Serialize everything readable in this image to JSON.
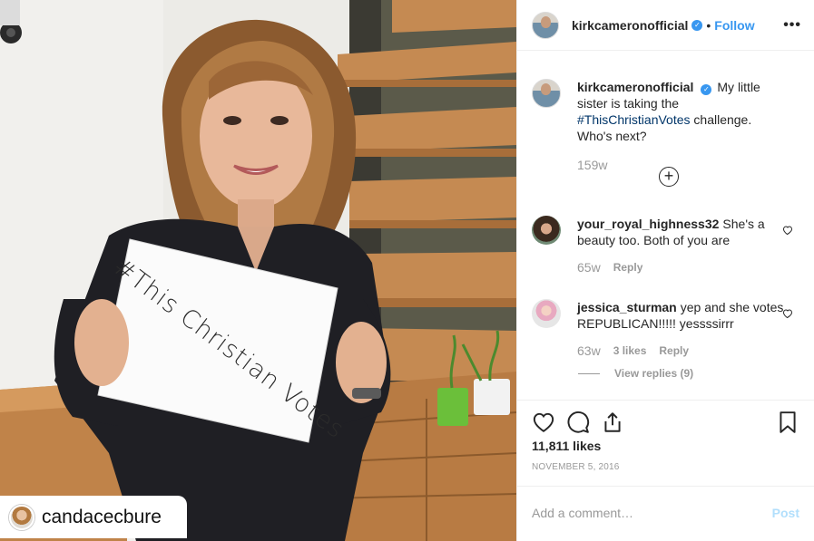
{
  "photo": {
    "sign_text": "#This Christian Votes",
    "repost_user": "candacecbure",
    "colors": {
      "wall": "#ecebe7",
      "stairs": "#c0824a",
      "shirt": "#1f1f24",
      "hair": "#8b5a2f",
      "pot_green": "#6bbf3a"
    }
  },
  "header": {
    "username": "kirkcameronofficial",
    "verified_icon": "verified-badge-icon",
    "separator": "•",
    "follow_label": "Follow",
    "more_label": "•••"
  },
  "caption": {
    "username": "kirkcameronofficial",
    "text_before": "My little sister is taking the ",
    "hashtag": "#ThisChristianVotes",
    "text_after": " challenge. Who's next?",
    "time": "159w",
    "load_more_label": "+"
  },
  "comments": [
    {
      "username": "your_royal_highness32",
      "text": "She's a beauty too. Both of you are",
      "time": "65w",
      "likes": "",
      "reply_label": "Reply"
    },
    {
      "username": "jessica_sturman",
      "text": "yep and she votes REPUBLICAN!!!!! yessssirrr",
      "time": "63w",
      "likes": "3 likes",
      "reply_label": "Reply",
      "view_replies": "View replies (9)"
    }
  ],
  "actions": {
    "likes": "11,811 likes",
    "date": "NOVEMBER 5, 2016"
  },
  "composer": {
    "placeholder": "Add a comment…",
    "post_label": "Post"
  },
  "theme": {
    "link_blue": "#3897f0",
    "muted": "#999999",
    "border": "#efefef"
  }
}
